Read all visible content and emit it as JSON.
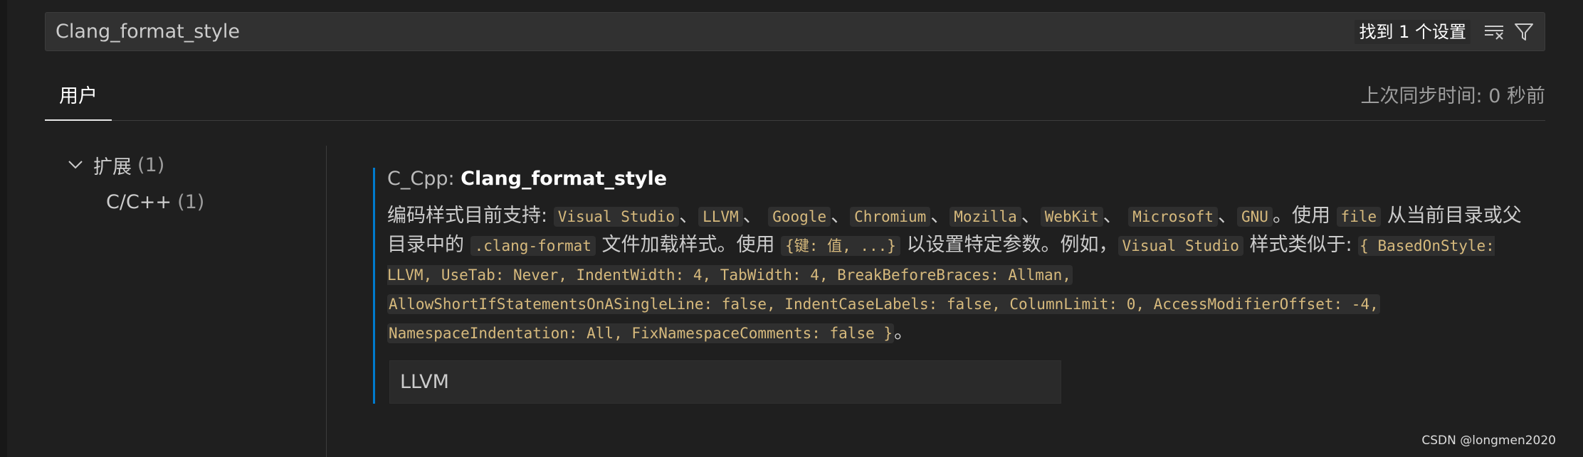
{
  "search": {
    "value": "Clang_format_style",
    "result_count": "找到 1 个设置"
  },
  "icons": {
    "clear_filters": "clear-filters-icon",
    "filter": "filter-icon",
    "chevron": "chevron-down-icon"
  },
  "tabs": [
    {
      "label": "用户",
      "active": true
    }
  ],
  "sync_status": "上次同步时间: 0 秒前",
  "toc": {
    "extensions": {
      "label": "扩展",
      "count": "(1)"
    },
    "cpp": {
      "label": "C/C++",
      "count": "(1)"
    }
  },
  "setting": {
    "category": "C_Cpp: ",
    "name": "Clang_format_style",
    "description": {
      "intro": "编码样式目前支持: ",
      "styles": [
        "Visual Studio",
        "LLVM",
        "Google",
        "Chromium",
        "Mozilla",
        "WebKit",
        "Microsoft",
        "GNU"
      ],
      "sep": "、",
      "use": "。使用 ",
      "file": "file",
      "from_dir": " 从当前目录或父目录中的 ",
      "clang_format": ".clang-format",
      "load": " 文件加载样式。使用 ",
      "kv": "{键: 值, ...}",
      "set_params": " 以设置特定参数。例如，",
      "example_style": "Visual Studio",
      "similar": " 样式类似于: ",
      "example_line1": "{ BasedOnStyle: LLVM, UseTab: Never, IndentWidth: 4, TabWidth: 4, BreakBeforeBraces: Allman,",
      "example_line2": "AllowShortIfStatementsOnASingleLine: false, IndentCaseLabels: false, ColumnLimit: 0, AccessModifierOffset: -4,",
      "example_line3": "NamespaceIndentation: All, FixNamespaceComments: false }",
      "end": "。"
    },
    "value": "LLVM"
  },
  "watermark": "CSDN @longmen2020",
  "colors": {
    "background": "#1f1f1f",
    "accent": "#007acc",
    "code_text": "#d7ba7d"
  }
}
